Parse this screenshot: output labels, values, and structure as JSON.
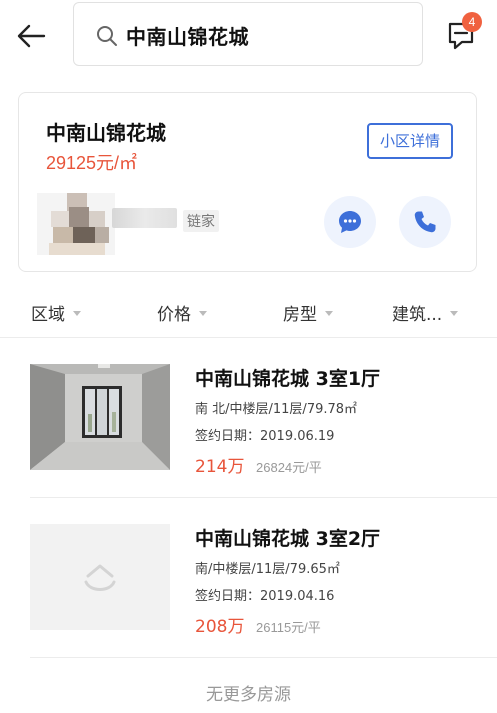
{
  "search": {
    "query": "中南山锦花城"
  },
  "messages": {
    "badge_count": "4"
  },
  "community": {
    "name": "中南山锦花城",
    "price": "29125元/㎡",
    "detail_button": "小区详情",
    "agent_company": "链家"
  },
  "filters": [
    {
      "label": "区域"
    },
    {
      "label": "价格"
    },
    {
      "label": "房型"
    },
    {
      "label": "建筑..."
    }
  ],
  "listings": [
    {
      "title": "中南山锦花城 3室1厅",
      "meta": "南 北/中楼层/11层/79.78㎡",
      "date": "签约日期：2019.06.19",
      "price": "214万",
      "unit_price": "26824元/平"
    },
    {
      "title": "中南山锦花城 3室2厅",
      "meta": "南/中楼层/11层/79.65㎡",
      "date": "签约日期：2019.04.16",
      "price": "208万",
      "unit_price": "26115元/平"
    }
  ],
  "footer": {
    "end_text": "无更多房源"
  },
  "colors": {
    "accent_red": "#e8553b",
    "accent_blue": "#3d6fd9",
    "badge": "#f0613f"
  }
}
